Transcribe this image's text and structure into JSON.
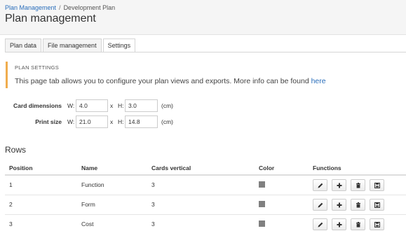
{
  "breadcrumb": {
    "root": "Plan Management",
    "separator": "/",
    "current": "Development Plan"
  },
  "page_title": "Plan management",
  "tabs": [
    {
      "label": "Plan data",
      "active": false
    },
    {
      "label": "File management",
      "active": false
    },
    {
      "label": "Settings",
      "active": true
    }
  ],
  "settings": {
    "heading": "PLAN SETTINGS",
    "description": "This page tab allows you to configure your plan views and exports. More info can be found ",
    "link": "here",
    "accent_color": "#f0ad4e"
  },
  "card_dimensions": {
    "label": "Card dimensions",
    "w_label": "W:",
    "w_value": "4.0",
    "x_label": "x",
    "h_label": "H:",
    "h_value": "3.0",
    "unit": "(cm)"
  },
  "print_size": {
    "label": "Print size",
    "w_label": "W:",
    "w_value": "21.0",
    "x_label": "x",
    "h_label": "H:",
    "h_value": "14.8",
    "unit": "(cm)"
  },
  "rows_section": {
    "title": "Rows",
    "headers": {
      "position": "Position",
      "name": "Name",
      "cards_vertical": "Cards vertical",
      "color": "Color",
      "functions": "Functions"
    },
    "rows": [
      {
        "position": "1",
        "name": "Function",
        "cards_vertical": "3",
        "color": "#808080"
      },
      {
        "position": "2",
        "name": "Form",
        "cards_vertical": "3",
        "color": "#808080"
      },
      {
        "position": "3",
        "name": "Cost",
        "cards_vertical": "3",
        "color": "#808080"
      }
    ],
    "function_icons": [
      "pencil-icon",
      "plus-icon",
      "trash-icon",
      "save-icon"
    ]
  }
}
